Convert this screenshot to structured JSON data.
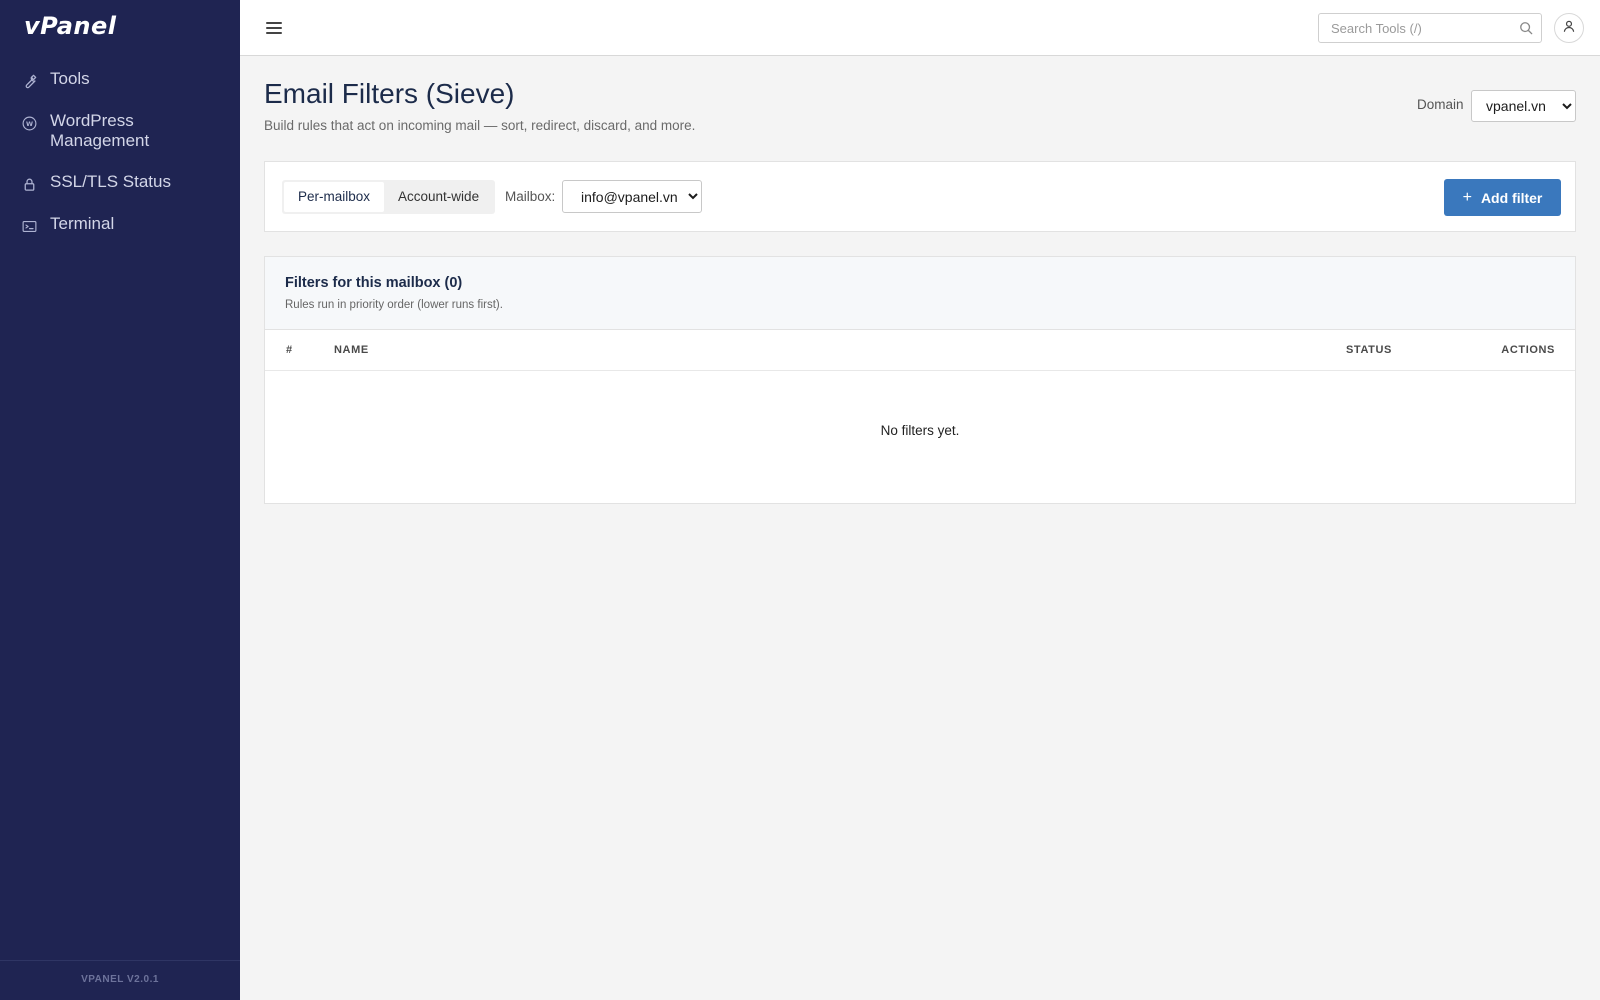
{
  "sidebar": {
    "logo": "vPanel",
    "items": [
      {
        "label": "Tools",
        "icon": "wrench-icon"
      },
      {
        "label": "WordPress Management",
        "icon": "wordpress-icon"
      },
      {
        "label": "SSL/TLS Status",
        "icon": "lock-icon"
      },
      {
        "label": "Terminal",
        "icon": "terminal-icon"
      }
    ],
    "version": "VPANEL V2.0.1"
  },
  "topbar": {
    "search_placeholder": "Search Tools (/)"
  },
  "page": {
    "title": "Email Filters (Sieve)",
    "subtitle": "Build rules that act on incoming mail — sort, redirect, discard, and more.",
    "domain_label": "Domain",
    "domain_value": "vpanel.vn"
  },
  "toolbar": {
    "tabs": [
      {
        "label": "Per-mailbox",
        "active": true
      },
      {
        "label": "Account-wide",
        "active": false
      }
    ],
    "mailbox_label": "Mailbox:",
    "mailbox_value": "info@vpanel.vn",
    "add_label": "Add filter",
    "add_icon": "+"
  },
  "filters": {
    "title": "Filters for this mailbox (0)",
    "subtitle": "Rules run in priority order (lower runs first).",
    "columns": [
      "#",
      "NAME",
      "STATUS",
      "ACTIONS"
    ],
    "empty_text": "No filters yet."
  },
  "colors": {
    "sidebar_bg": "#1f2452",
    "accent": "#3a78bd",
    "page_bg": "#f4f4f4"
  }
}
